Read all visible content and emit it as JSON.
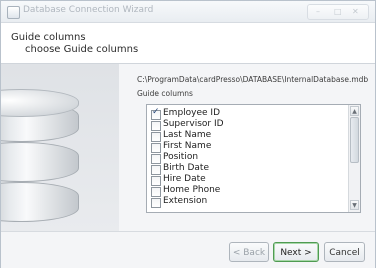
{
  "window": {
    "title": "Database Connection Wizard",
    "controls": [
      "–",
      "□",
      "✕"
    ]
  },
  "header": {
    "title": "Guide  columns",
    "subtitle": "choose Guide columns"
  },
  "main": {
    "db_path": "C:\\ProgramData\\cardPresso\\DATABASE\\InternalDatabase.mdb",
    "columns_label": "Guide columns",
    "columns": [
      {
        "label": "Employee ID",
        "checked": true
      },
      {
        "label": "Supervisor ID",
        "checked": false
      },
      {
        "label": "Last Name",
        "checked": false
      },
      {
        "label": "First Name",
        "checked": false
      },
      {
        "label": "Position",
        "checked": false
      },
      {
        "label": "Birth Date",
        "checked": false
      },
      {
        "label": "Hire Date",
        "checked": false
      },
      {
        "label": "Home Phone",
        "checked": false
      },
      {
        "label": "Extension",
        "checked": false
      }
    ]
  },
  "footer": {
    "back_label": "< Back",
    "next_label": "Next >",
    "cancel_label": "Cancel"
  },
  "colors": {
    "focus_green": "#4f9b52",
    "window_border": "#b9c2cc"
  }
}
